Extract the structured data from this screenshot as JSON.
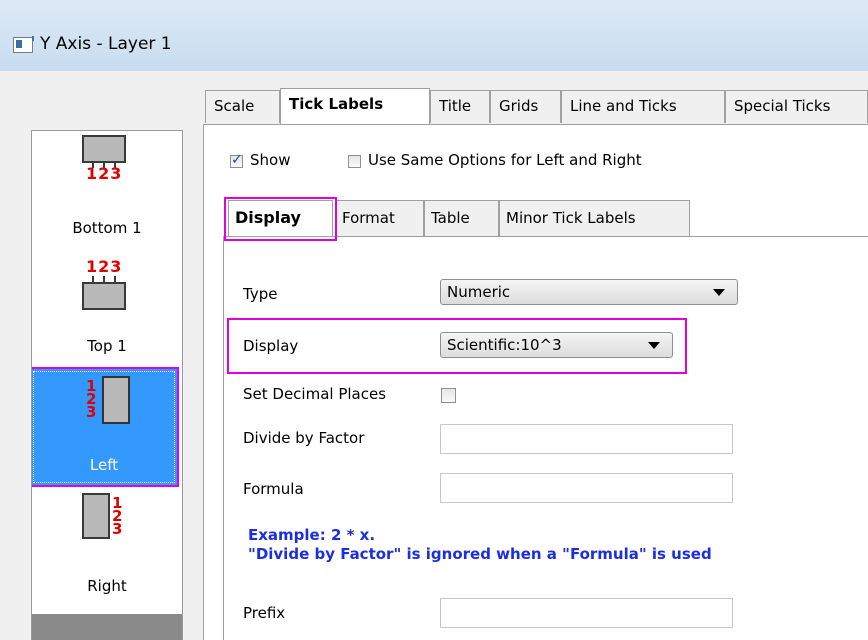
{
  "window": {
    "title": "Y Axis - Layer 1"
  },
  "axis_list": {
    "items": [
      {
        "label": "Bottom 1",
        "nums": "123"
      },
      {
        "label": "Top 1",
        "nums": "123"
      },
      {
        "label": "Left",
        "nums": [
          "1",
          "2",
          "3"
        ],
        "selected": true
      },
      {
        "label": "Right",
        "nums": [
          "1",
          "2",
          "3"
        ]
      }
    ]
  },
  "tabs": [
    "Scale",
    "Tick Labels",
    "Title",
    "Grids",
    "Line and Ticks",
    "Special Ticks"
  ],
  "active_tab": "Tick Labels",
  "options": {
    "show_label": "Show",
    "show_checked": true,
    "same_options_label": "Use Same Options for Left and Right",
    "same_options_checked": false
  },
  "subtabs": [
    "Display",
    "Format",
    "Table",
    "Minor Tick Labels"
  ],
  "active_subtab": "Display",
  "form": {
    "type_label": "Type",
    "type_value": "Numeric",
    "display_label": "Display",
    "display_value": "Scientific:10^3",
    "decimal_label": "Set Decimal Places",
    "decimal_checked": false,
    "divide_label": "Divide by Factor",
    "divide_value": "",
    "formula_label": "Formula",
    "formula_value": "",
    "prefix_label": "Prefix",
    "prefix_value": ""
  },
  "example": {
    "line1": "Example: 2 * x.",
    "line2": "\"Divide by Factor\" is ignored when a \"Formula\" is used"
  },
  "colors": {
    "highlight": "#e100e1",
    "selection": "#3399ff",
    "axis_numbers": "#e00000",
    "example_text": "#1b2ee0"
  }
}
